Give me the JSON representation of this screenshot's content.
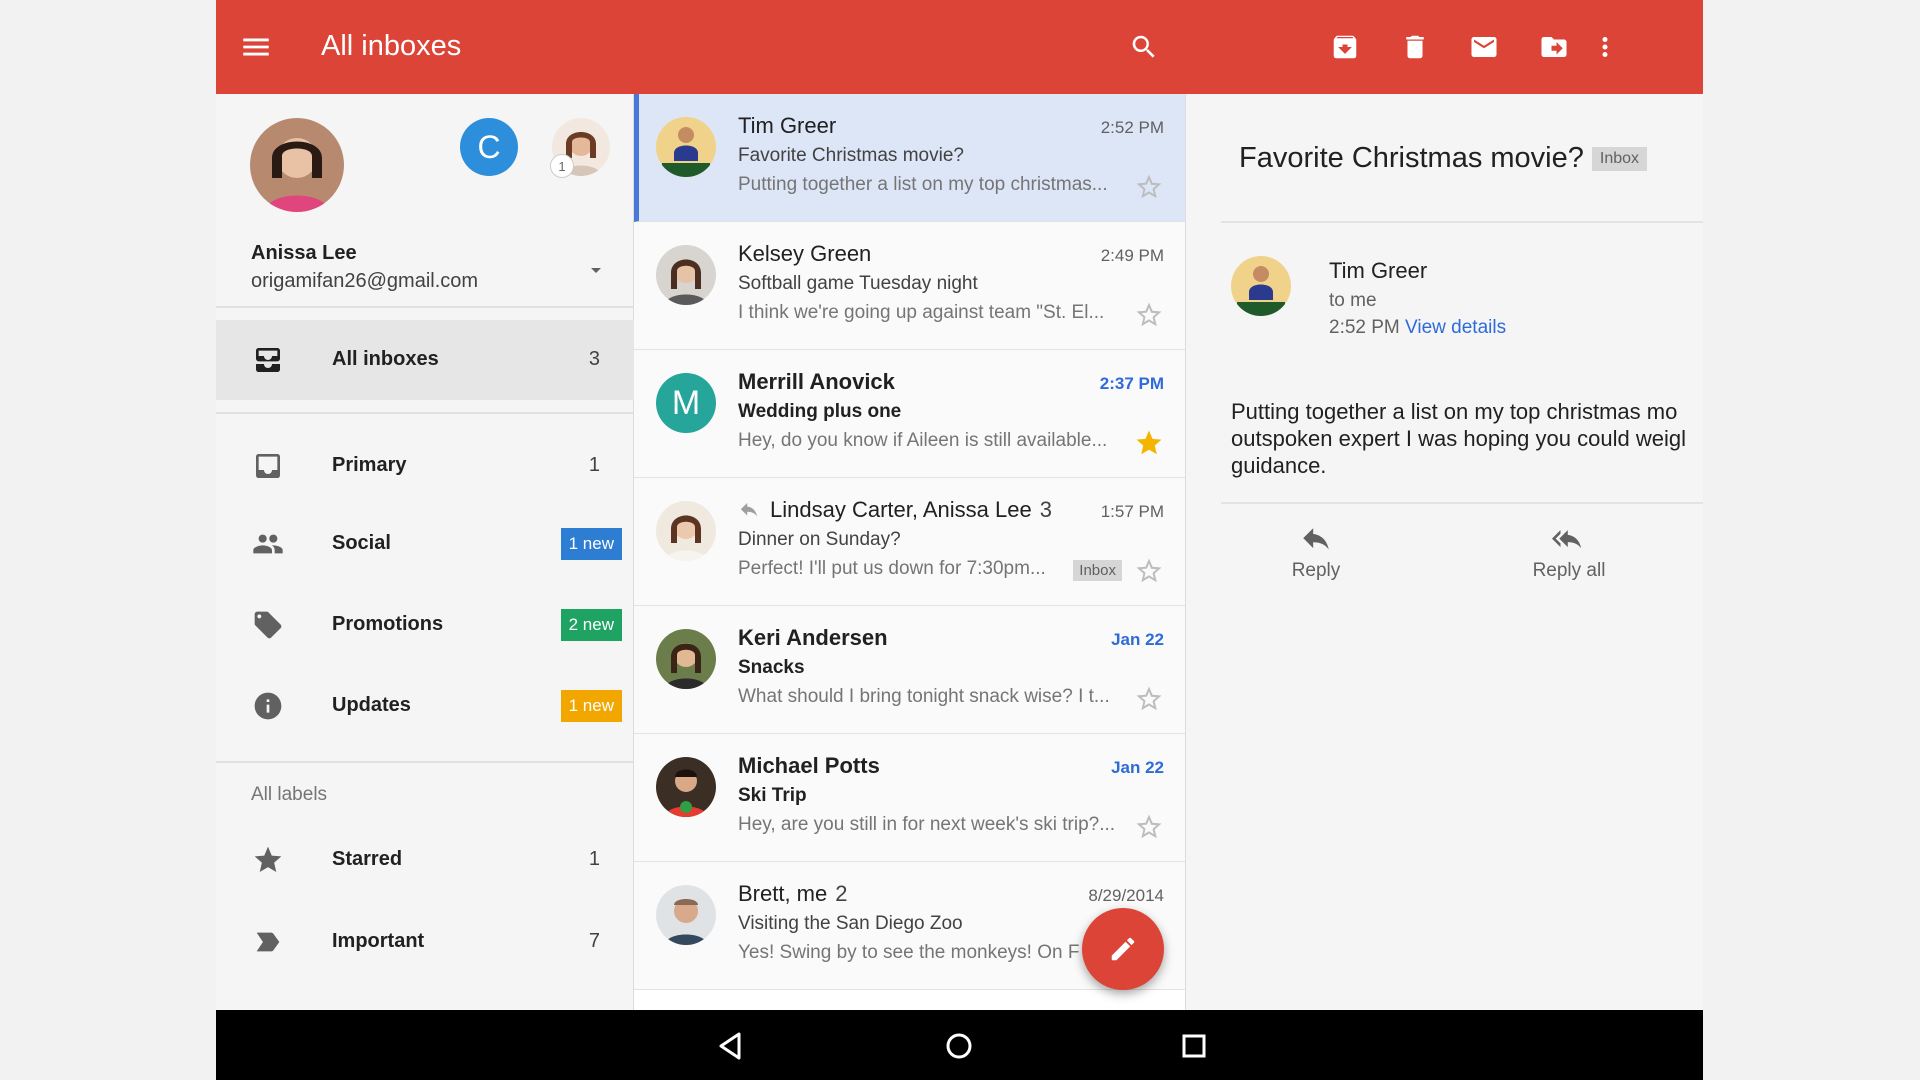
{
  "toolbar": {
    "title": "All inboxes",
    "icons": [
      "menu-icon",
      "search-icon",
      "archive-icon",
      "delete-icon",
      "mark-unread-icon",
      "move-to-icon",
      "more-vert-icon"
    ],
    "color": "#db4437"
  },
  "account": {
    "name": "Anissa Lee",
    "email": "origamifan26@gmail.com",
    "other_account_initial": "C",
    "other_account_badge": "1"
  },
  "nav": {
    "all_inboxes": {
      "label": "All inboxes",
      "count": "3"
    },
    "primary": {
      "label": "Primary",
      "count": "1"
    },
    "social": {
      "label": "Social",
      "badge": "1 new",
      "badge_color": "#2d7dd2"
    },
    "promotions": {
      "label": "Promotions",
      "badge": "2 new",
      "badge_color": "#1ea362"
    },
    "updates": {
      "label": "Updates",
      "badge": "1 new",
      "badge_color": "#f2a600"
    },
    "section_label": "All labels",
    "starred": {
      "label": "Starred",
      "count": "1"
    },
    "important": {
      "label": "Important",
      "count": "7"
    }
  },
  "conversations": [
    {
      "sender": "Tim Greer",
      "time": "2:52 PM",
      "subject": "Favorite Christmas movie?",
      "snippet": "Putting together a list on my top christmas...",
      "starred": false,
      "unread": false,
      "selected": true
    },
    {
      "sender": "Kelsey Green",
      "time": "2:49 PM",
      "subject": "Softball game Tuesday night",
      "snippet": "I think we're going up against team \"St. El...",
      "starred": false,
      "unread": false
    },
    {
      "sender": "Merrill Anovick",
      "time": "2:37 PM",
      "subject": "Wedding plus one",
      "snippet": "Hey, do you know if Aileen is still available...",
      "starred": true,
      "unread": true,
      "initial": "M"
    },
    {
      "sender": "Lindsay Carter, Anissa Lee",
      "thread_count": "3",
      "time": "1:57 PM",
      "subject": "Dinner on Sunday?",
      "snippet": "Perfect! I'll put us down for 7:30pm...",
      "chip": "Inbox",
      "starred": false,
      "unread": false,
      "replied": true
    },
    {
      "sender": "Keri Andersen",
      "time": "Jan 22",
      "subject": "Snacks",
      "snippet": "What should I bring tonight snack wise? I t...",
      "starred": false,
      "unread": true
    },
    {
      "sender": "Michael Potts",
      "time": "Jan 22",
      "subject": "Ski Trip",
      "snippet": "Hey, are you still in for next week's ski trip?...",
      "starred": false,
      "unread": true
    },
    {
      "sender": "Brett, me",
      "thread_count": "2",
      "time": "8/29/2014",
      "subject": "Visiting the San Diego Zoo",
      "snippet": "Yes! Swing by to see the monkeys! On F",
      "starred": false,
      "unread": false
    }
  ],
  "reading": {
    "subject": "Favorite Christmas movie?",
    "chip": "Inbox",
    "from": "Tim Greer",
    "to": "to me",
    "time": "2:52 PM",
    "details_link": "View details",
    "body": "Putting together a list on my top christmas mo\noutspoken expert I was hoping you could weigl\nguidance.",
    "reply_label": "Reply",
    "reply_all_label": "Reply all"
  },
  "colors": {
    "accent": "#db4437",
    "selected_row": "#dde6f7",
    "link": "#2f6bd8",
    "star": "#f4b400"
  }
}
